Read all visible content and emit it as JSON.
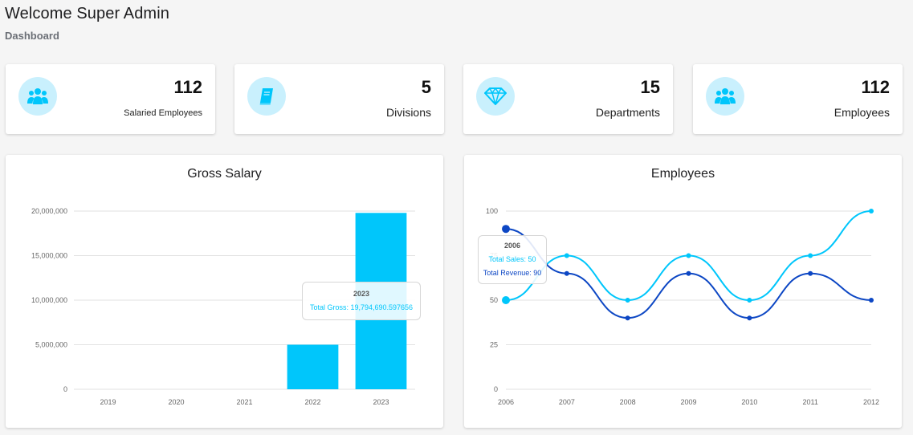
{
  "header": {
    "title": "Welcome Super Admin",
    "breadcrumb": "Dashboard"
  },
  "stats": [
    {
      "value": "112",
      "label": "Salaried Employees",
      "icon": "users-icon"
    },
    {
      "value": "5",
      "label": "Divisions",
      "icon": "book-icon"
    },
    {
      "value": "15",
      "label": "Departments",
      "icon": "diamond-icon"
    },
    {
      "value": "112",
      "label": "Employees",
      "icon": "users-icon"
    }
  ],
  "colors": {
    "accent": "#00c6fb",
    "accent_light": "#c9f0fd",
    "dark_blue": "#0d47c4"
  },
  "chart_data": [
    {
      "type": "bar",
      "title": "Gross Salary",
      "categories": [
        "2019",
        "2020",
        "2021",
        "2022",
        "2023"
      ],
      "values": [
        0,
        0,
        0,
        5000000,
        19794690.597656
      ],
      "ylim": [
        0,
        20000000
      ],
      "yticks": [
        "0",
        "5,000,000",
        "10,000,000",
        "15,000,000",
        "20,000,000"
      ],
      "grid": true,
      "tooltip": {
        "title": "2023",
        "text": "Total Gross: 19,794,690.597656"
      }
    },
    {
      "type": "line",
      "title": "Employees",
      "categories": [
        "2006",
        "2007",
        "2008",
        "2009",
        "2010",
        "2011",
        "2012"
      ],
      "series": [
        {
          "name": "Total Sales",
          "color": "#00c6fb",
          "values": [
            50,
            75,
            50,
            75,
            50,
            75,
            100
          ]
        },
        {
          "name": "Total Revenue",
          "color": "#0d47c4",
          "values": [
            90,
            65,
            40,
            65,
            40,
            65,
            50
          ]
        }
      ],
      "ylim": [
        0,
        100
      ],
      "yticks": [
        "0",
        "25",
        "50",
        "75",
        "100"
      ],
      "grid": true,
      "tooltip": {
        "title": "2006",
        "sales": "Total Sales: 50",
        "revenue": "Total Revenue: 90"
      }
    }
  ]
}
